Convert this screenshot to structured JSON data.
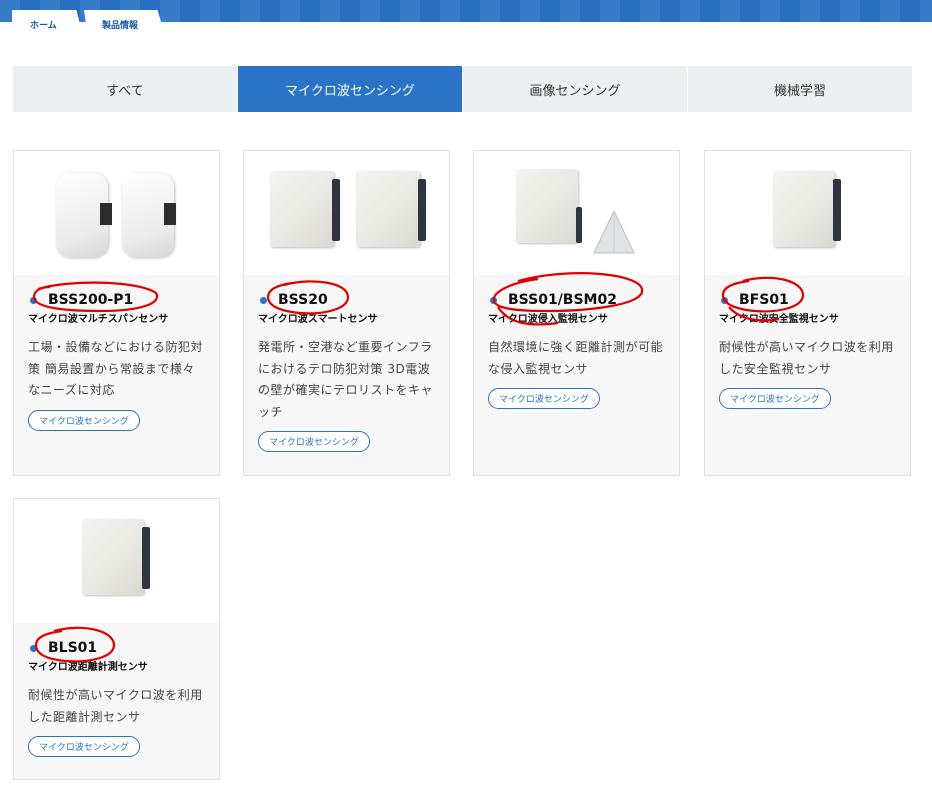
{
  "breadcrumb": {
    "home": "ホーム",
    "current": "製品情報"
  },
  "tabs": [
    {
      "label": "すべて",
      "active": false
    },
    {
      "label": "マイクロ波センシング",
      "active": true
    },
    {
      "label": "画像センシング",
      "active": false
    },
    {
      "label": "機械学習",
      "active": false
    }
  ],
  "products": [
    {
      "name": "BSS200-P1",
      "subtitle": "マイクロ波マルチスパンセンサ",
      "description": "工場・設備などにおける防犯対策 簡易設置から常設まで様々なニーズに対応",
      "tag": "マイクロ波センシング"
    },
    {
      "name": "BSS20",
      "subtitle": "マイクロ波スマートセンサ",
      "description": "発電所・空港など重要インフラにおけるテロ防犯対策 3D電波の壁が確実にテロリストをキャッチ",
      "tag": "マイクロ波センシング"
    },
    {
      "name": "BSS01/BSM02",
      "subtitle": "マイクロ波侵入監視センサ",
      "description": "自然環境に強く距離計測が可能な侵入監視センサ",
      "tag": "マイクロ波センシング"
    },
    {
      "name": "BFS01",
      "subtitle": "マイクロ波安全監視センサ",
      "description": "耐候性が高いマイクロ波を利用した安全監視センサ",
      "tag": "マイクロ波センシング"
    },
    {
      "name": "BLS01",
      "subtitle": "マイクロ波距離計測センサ",
      "description": "耐候性が高いマイクロ波を利用した距離計測センサ",
      "tag": "マイクロ波センシング"
    }
  ],
  "colors": {
    "accent": "#2a73c6",
    "annotation": "#e00000"
  }
}
